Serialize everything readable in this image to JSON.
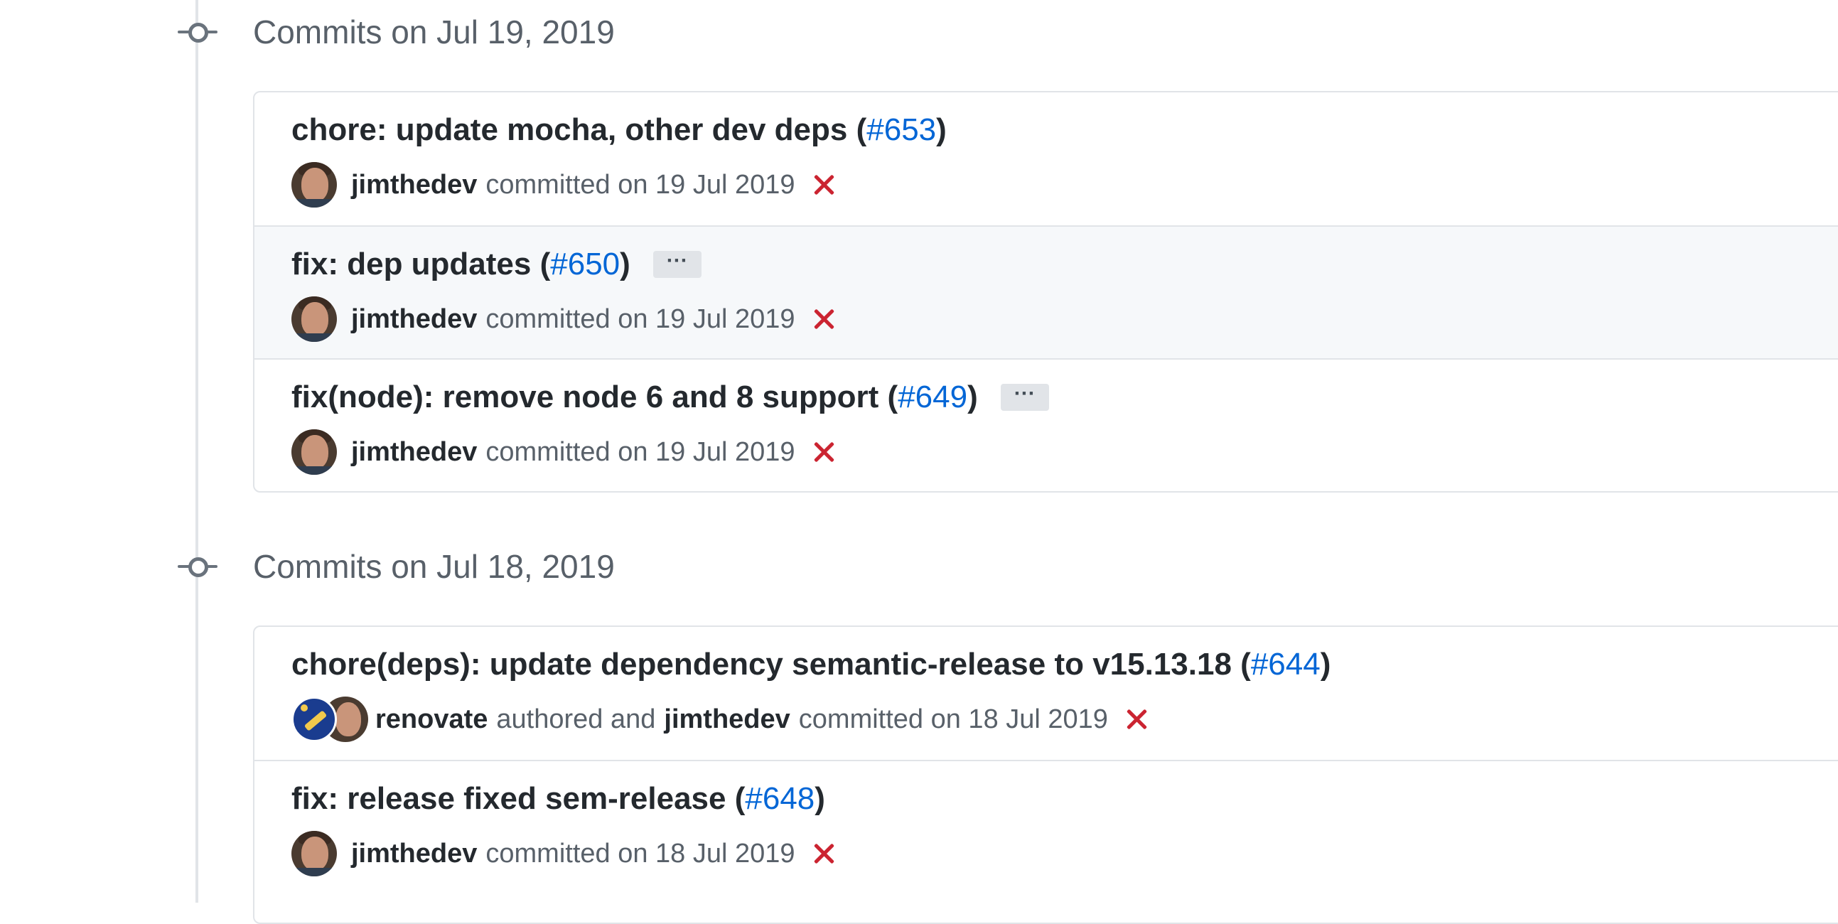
{
  "groups": [
    {
      "title": "Commits on Jul 19, 2019",
      "commits": [
        {
          "title": "chore: update mocha, other dev deps (",
          "pr": "#653",
          "title_end": ")",
          "has_ellipsis": false,
          "author": "jimthedev",
          "meta": "committed on 19 Jul 2019",
          "status": "failure"
        },
        {
          "title": "fix: dep updates (",
          "pr": "#650",
          "title_end": ")",
          "has_ellipsis": true,
          "ellipsis": "···",
          "author": "jimthedev",
          "meta": "committed on 19 Jul 2019",
          "status": "failure"
        },
        {
          "title": "fix(node): remove node 6 and 8 support (",
          "pr": "#649",
          "title_end": ")",
          "has_ellipsis": true,
          "ellipsis": "···",
          "author": "jimthedev",
          "meta": "committed on 19 Jul 2019",
          "status": "failure"
        }
      ]
    },
    {
      "title": "Commits on Jul 18, 2019",
      "commits": [
        {
          "title": "chore(deps): update dependency semantic-release to v15.13.18 (",
          "pr": "#644",
          "title_end": ")",
          "has_ellipsis": false,
          "author": "renovate",
          "authored_text": "authored and",
          "committer": "jimthedev",
          "meta": "committed on 18 Jul 2019",
          "status": "failure"
        },
        {
          "title": "fix: release fixed sem-release (",
          "pr": "#648",
          "title_end": ")",
          "has_ellipsis": false,
          "author": "jimthedev",
          "meta": "committed on 18 Jul 2019",
          "status": "failure"
        }
      ]
    }
  ],
  "colors": {
    "link": "#0366d6",
    "failure": "#cb2431",
    "border": "#e1e4e8",
    "muted": "#586069"
  }
}
